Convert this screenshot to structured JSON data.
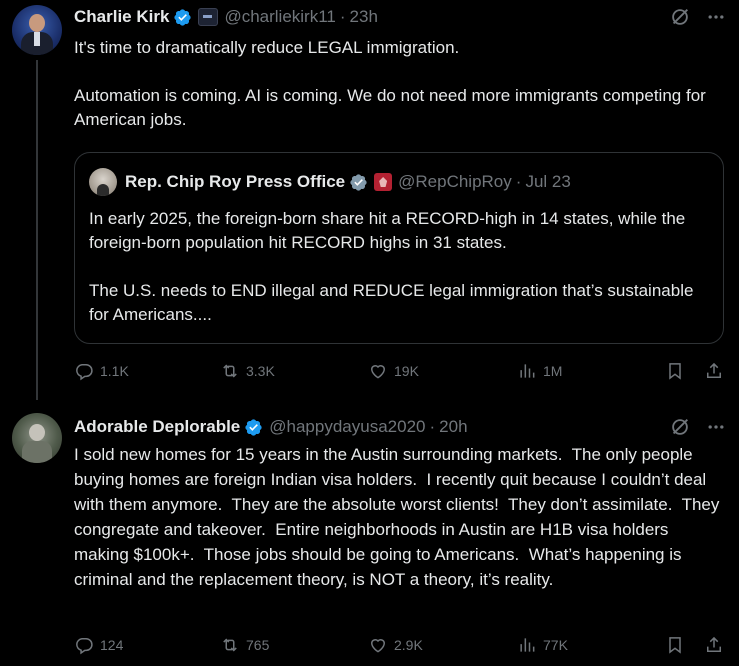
{
  "tweets": [
    {
      "author": "Charlie Kirk",
      "handle": "@charliekirk11",
      "time": "23h",
      "text": "It's time to dramatically reduce LEGAL immigration.\n\nAutomation is coming. AI is coming. We do not need more immigrants competing for American jobs.",
      "quote": {
        "author": "Rep. Chip Roy Press Office",
        "handle": "@RepChipRoy",
        "time": "Jul 23",
        "text": "In early 2025, the foreign-born share hit a RECORD-high in 14 states, while the foreign-born population hit RECORD highs in 31 states.\n\nThe U.S. needs to END illegal and REDUCE legal immigration that’s sustainable for Americans...."
      },
      "stats": {
        "replies": "1.1K",
        "reposts": "3.3K",
        "likes": "19K",
        "views": "1M"
      }
    },
    {
      "author": "Adorable Deplorable",
      "handle": "@happydayusa2020",
      "time": "20h",
      "text": "I sold new homes for 15 years in the Austin surrounding markets.  The only people buying homes are foreign Indian visa holders.  I recently quit because I couldn’t deal with them anymore.  They are the absolute worst clients!  They don’t assimilate.  They congregate and takeover.  Entire neighborhoods in Austin are H1B visa holders making $100k+.  Those jobs should be going to Americans.  What’s happening is criminal and the replacement theory, is NOT a theory, it’s reality.",
      "stats": {
        "replies": "124",
        "reposts": "765",
        "likes": "2.9K",
        "views": "77K"
      }
    }
  ],
  "ui": {
    "separator": "·",
    "accent": "#1d9bf0",
    "muted": "#71767b"
  }
}
